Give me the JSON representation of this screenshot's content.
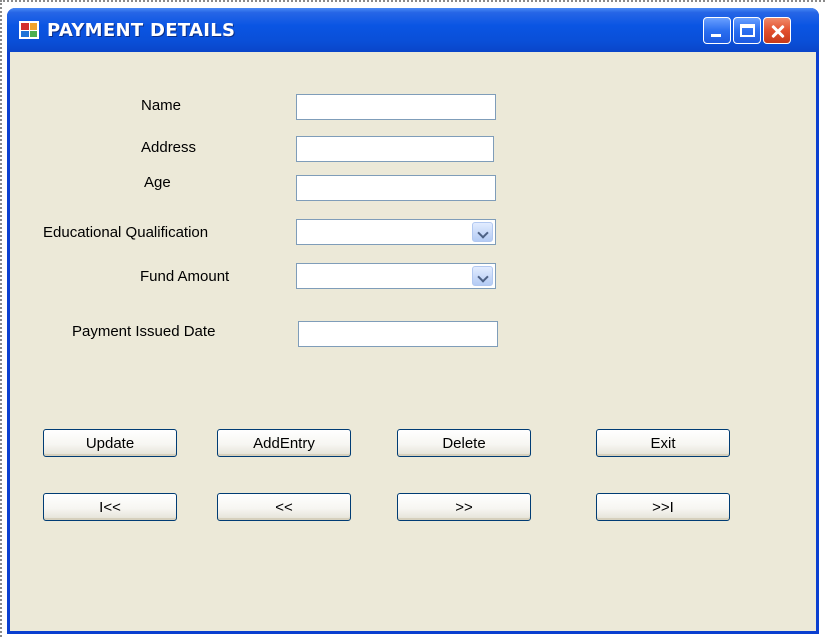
{
  "window": {
    "title": "PAYMENT DETAILS"
  },
  "form": {
    "name_label": "Name",
    "name_value": "",
    "address_label": "Address",
    "address_value": "",
    "age_label": "Age",
    "age_value": "",
    "qualification_label": "Educational Qualification",
    "qualification_value": "",
    "fund_label": "Fund Amount",
    "fund_value": "",
    "date_label": "Payment Issued Date",
    "date_value": ""
  },
  "buttons": {
    "update": "Update",
    "add_entry": "AddEntry",
    "delete": "Delete",
    "exit": "Exit",
    "first": "I<<",
    "previous": "<<",
    "next": ">>",
    "last": ">>I"
  },
  "icons": {
    "app": "app-window-icon",
    "minimize": "minimize-icon",
    "maximize": "maximize-icon",
    "close": "close-icon",
    "dropdown": "chevron-down-icon"
  },
  "colors": {
    "titlebar": "#0a55e3",
    "window_bg": "#ece9d8",
    "close_button": "#e2502e"
  }
}
